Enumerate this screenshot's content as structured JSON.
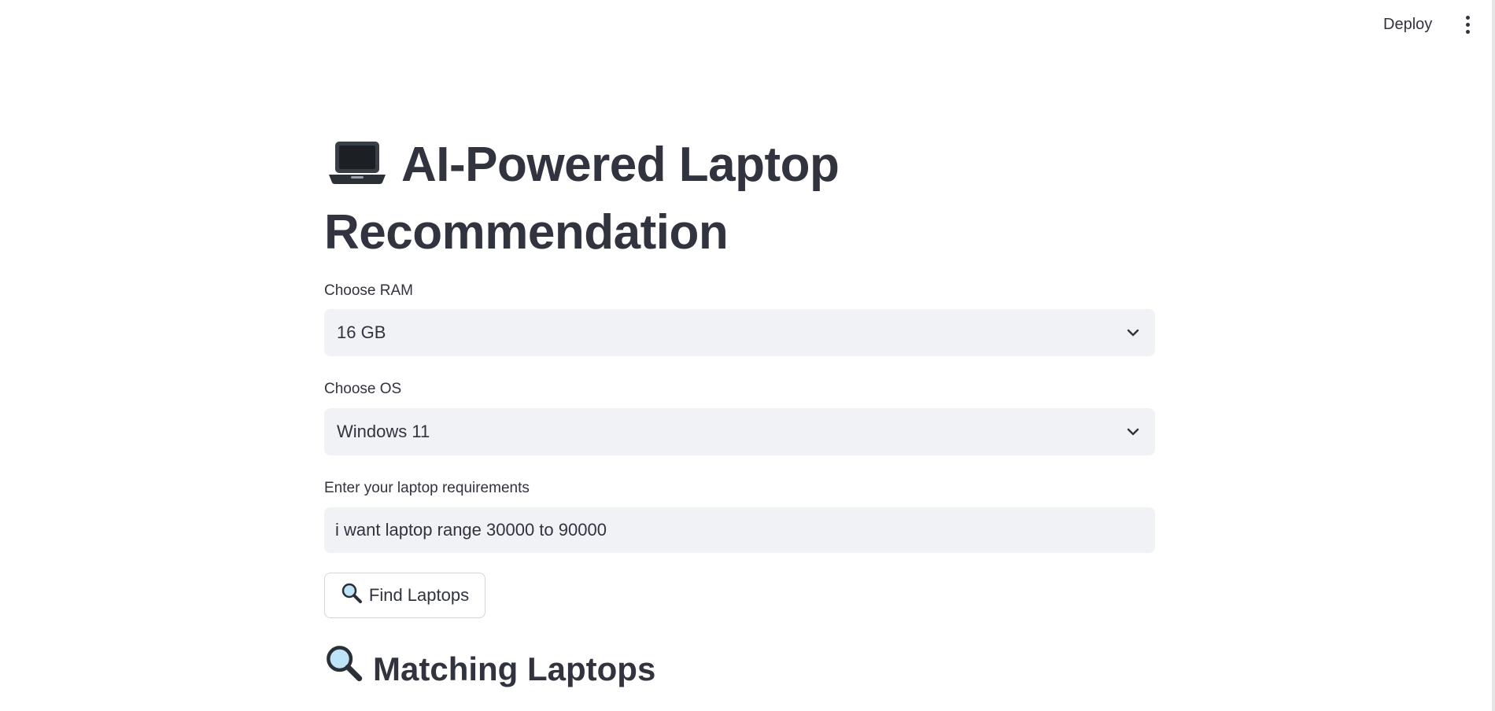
{
  "header": {
    "deploy_label": "Deploy",
    "menu_icon": "vertical-ellipsis-icon"
  },
  "main": {
    "title_icon": "laptop-icon",
    "title": "AI-Powered Laptop Recommendation",
    "ram": {
      "label": "Choose RAM",
      "selected": "16 GB"
    },
    "os": {
      "label": "Choose OS",
      "selected": "Windows 11"
    },
    "requirements": {
      "label": "Enter your laptop requirements",
      "value": "i want laptop range 30000 to 90000"
    },
    "find_button": {
      "icon": "magnifier-icon",
      "label": "Find Laptops"
    },
    "results": {
      "icon": "magnifier-icon",
      "heading": "Matching Laptops"
    }
  },
  "colors": {
    "text": "#31333f",
    "input_bg": "#f0f2f6",
    "button_border": "#d6d6d9",
    "background": "#ffffff"
  }
}
